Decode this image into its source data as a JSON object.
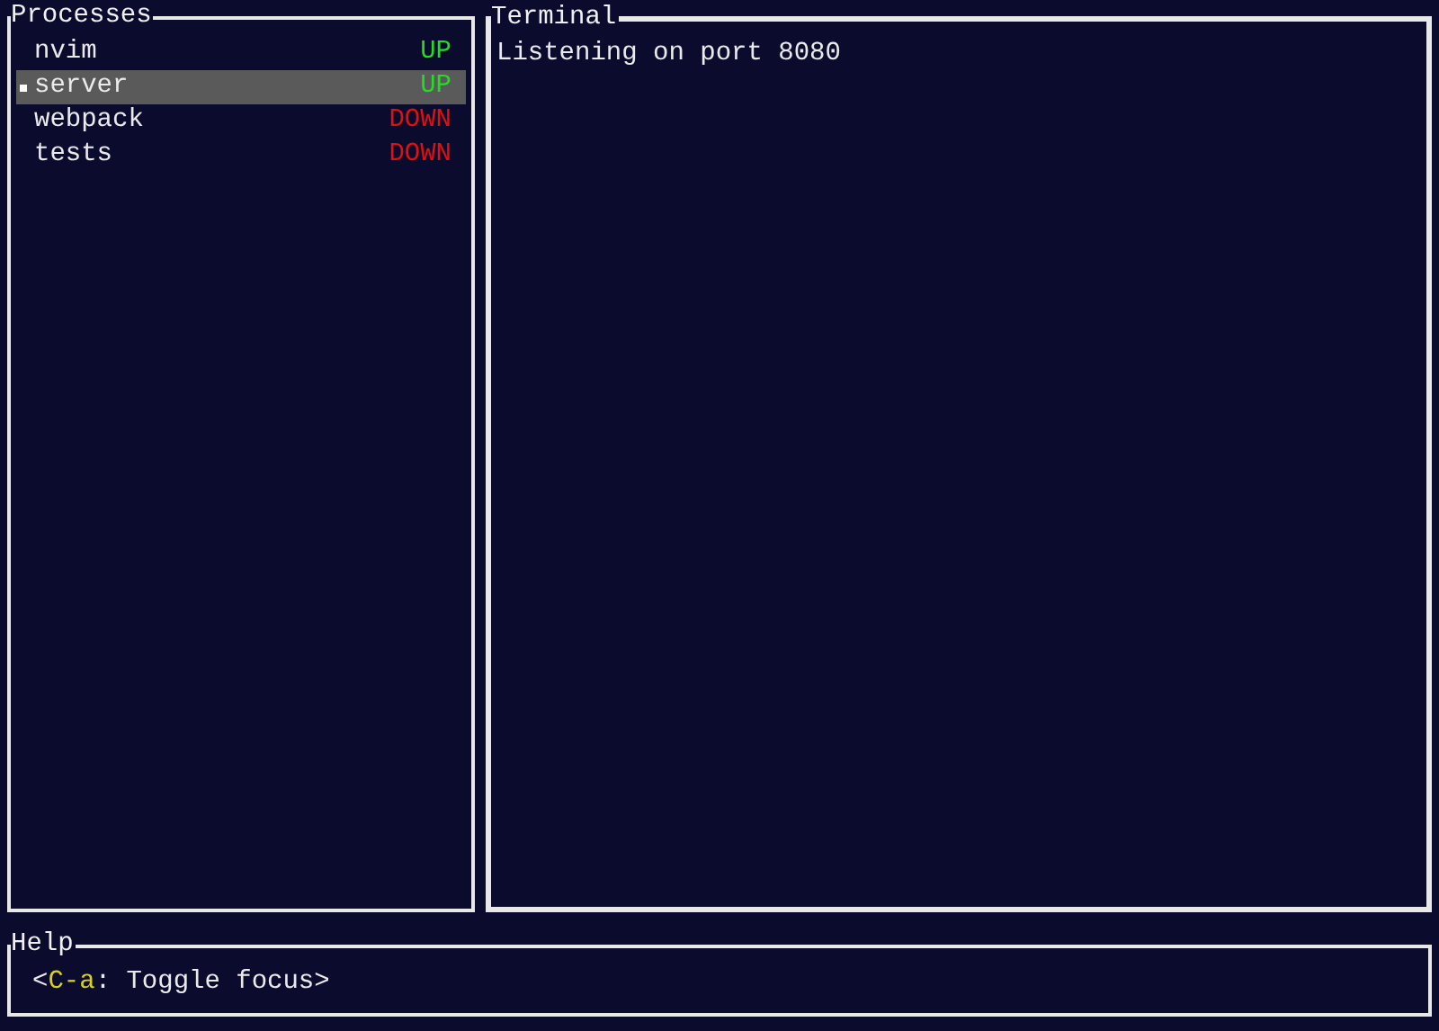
{
  "processes": {
    "title": "Processes",
    "focused": false,
    "items": [
      {
        "name": "nvim",
        "status": "UP",
        "up": true,
        "selected": false
      },
      {
        "name": "server",
        "status": "UP",
        "up": true,
        "selected": true
      },
      {
        "name": "webpack",
        "status": "DOWN",
        "up": false,
        "selected": false
      },
      {
        "name": "tests",
        "status": "DOWN",
        "up": false,
        "selected": false
      }
    ]
  },
  "terminal": {
    "title": "Terminal",
    "focused": true,
    "lines": [
      "Listening on port 8080"
    ]
  },
  "help": {
    "title": "Help",
    "open": "<",
    "key": "C-a",
    "text": ": Toggle focus>"
  }
}
